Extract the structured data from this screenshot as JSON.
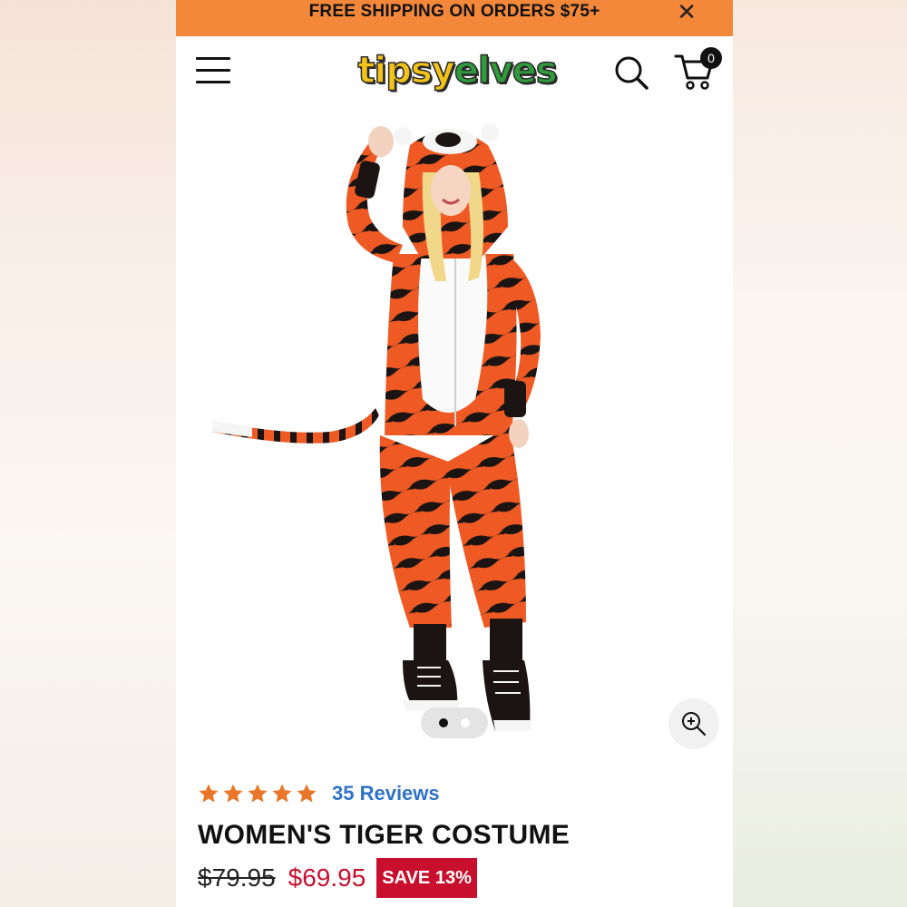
{
  "promo": {
    "text": "FREE SHIPPING ON ORDERS $75+",
    "close_icon": "close-icon"
  },
  "header": {
    "logo_part1": "tipsy",
    "logo_part2": "elves",
    "cart_count": "0",
    "icons": [
      "menu-icon",
      "search-icon",
      "cart-icon"
    ]
  },
  "gallery": {
    "image_count": 2,
    "active_index": 0,
    "zoom_icon": "zoom-in-icon"
  },
  "product": {
    "rating": 5,
    "reviews_label": "35 Reviews",
    "title": "WOMEN'S TIGER COSTUME",
    "original_price": "$79.95",
    "sale_price": "$69.95",
    "save_label": "SAVE 13%"
  },
  "colors": {
    "promo_bg": "#f4883a",
    "star": "#e8772a",
    "link": "#2f73c9",
    "sale": "#c8102e"
  }
}
